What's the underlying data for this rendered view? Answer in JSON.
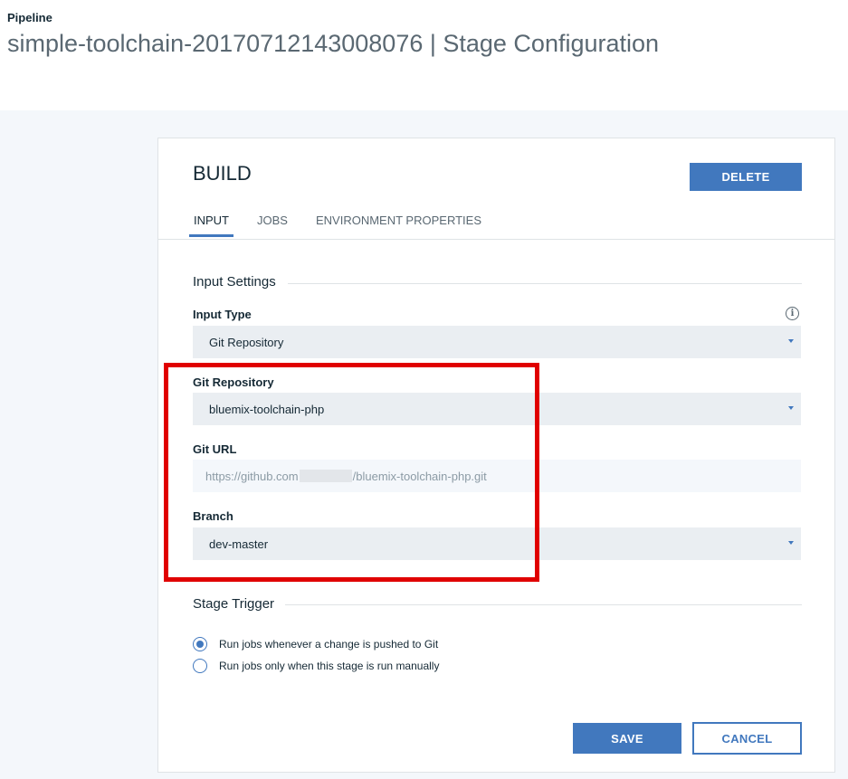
{
  "header": {
    "breadcrumb": "Pipeline",
    "title": "simple-toolchain-20170712143008076 | Stage Configuration"
  },
  "stage": {
    "name": "BUILD",
    "delete_label": "DELETE",
    "tabs": [
      {
        "label": "INPUT",
        "active": true
      },
      {
        "label": "JOBS",
        "active": false
      },
      {
        "label": "ENVIRONMENT PROPERTIES",
        "active": false
      }
    ]
  },
  "input_settings": {
    "heading": "Input Settings",
    "input_type": {
      "label": "Input Type",
      "value": "Git Repository"
    },
    "git_repository": {
      "label": "Git Repository",
      "value": "bluemix-toolchain-php"
    },
    "git_url": {
      "label": "Git URL",
      "value_prefix": "https://github.com",
      "value_suffix": "/bluemix-toolchain-php.git"
    },
    "branch": {
      "label": "Branch",
      "value": "dev-master"
    }
  },
  "stage_trigger": {
    "heading": "Stage Trigger",
    "options": [
      {
        "label": "Run jobs whenever a change is pushed to Git",
        "selected": true
      },
      {
        "label": "Run jobs only when this stage is run manually",
        "selected": false
      }
    ]
  },
  "actions": {
    "save_label": "SAVE",
    "cancel_label": "CANCEL"
  },
  "icons": {
    "info": "info-icon",
    "caret": "caret-down-icon"
  },
  "colors": {
    "accent": "#4178be",
    "highlight": "#e00000",
    "field_bg": "#eaeef2",
    "page_bg": "#f4f7fb"
  }
}
